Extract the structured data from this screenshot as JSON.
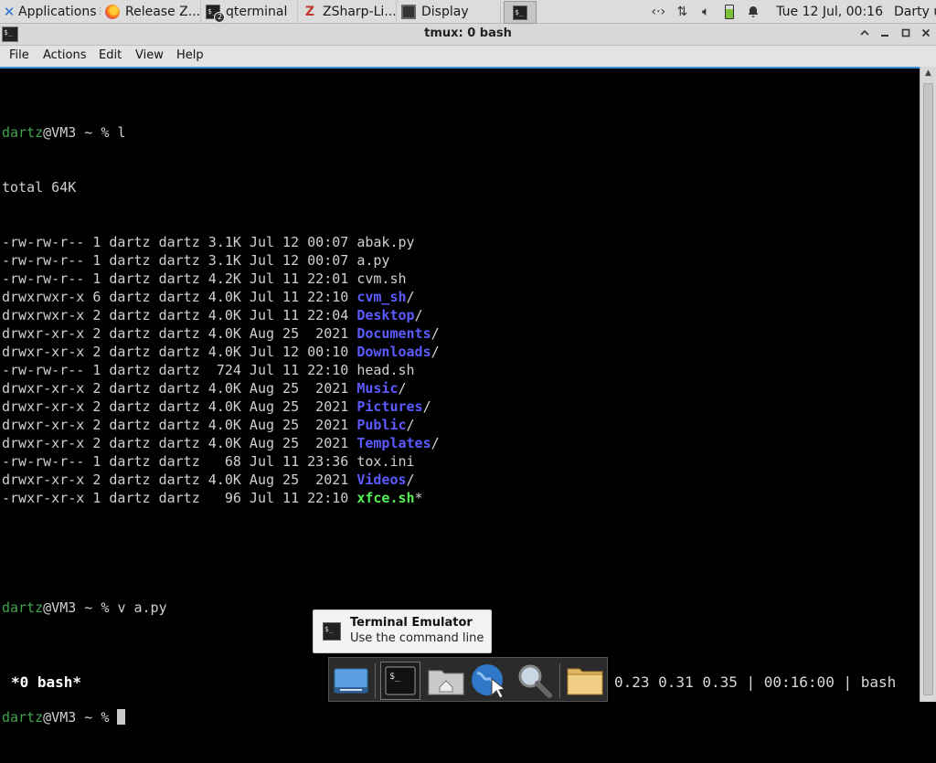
{
  "top_panel": {
    "apps_label": "Applications",
    "apps_suffix": "☰",
    "tasks": [
      {
        "label": "Release Z...",
        "icon": "firefox-icon"
      },
      {
        "label": "qterminal",
        "icon": "terminal-icon",
        "badge": "2"
      },
      {
        "label": "ZSharp-Li...",
        "icon": "zsharp-icon"
      },
      {
        "label": "Display",
        "icon": "display-icon"
      },
      {
        "label": "",
        "icon": "terminal-icon"
      }
    ],
    "tray_icons": [
      "network-arrows-icon",
      "transfer-icon",
      "volume-icon",
      "battery-icon",
      "notification-bell-icon"
    ],
    "clock": "Tue 12 Jul, 00:16",
    "user": "Darty uwu"
  },
  "window": {
    "title": "tmux: 0 bash",
    "buttons": [
      "minimize",
      "restore",
      "maximize",
      "close"
    ]
  },
  "menubar": {
    "items": [
      "File",
      "Actions",
      "Edit",
      "View",
      "Help"
    ]
  },
  "terminal": {
    "prompt_user": "dartz",
    "prompt_host": "@VM3",
    "prompt_suffix": " ~ % ",
    "cmd1": "l",
    "total": "total 64K",
    "listing": [
      {
        "meta": "-rw-rw-r-- 1 dartz dartz 3.1K Jul 12 00:07 ",
        "name": "abak.py",
        "kind": "file",
        "suffix": ""
      },
      {
        "meta": "-rw-rw-r-- 1 dartz dartz 3.1K Jul 12 00:07 ",
        "name": "a.py",
        "kind": "file",
        "suffix": ""
      },
      {
        "meta": "-rw-rw-r-- 1 dartz dartz 4.2K Jul 11 22:01 ",
        "name": "cvm.sh",
        "kind": "file",
        "suffix": ""
      },
      {
        "meta": "drwxrwxr-x 6 dartz dartz 4.0K Jul 11 22:10 ",
        "name": "cvm_sh",
        "kind": "dir",
        "suffix": "/"
      },
      {
        "meta": "drwxrwxr-x 2 dartz dartz 4.0K Jul 11 22:04 ",
        "name": "Desktop",
        "kind": "dir",
        "suffix": "/"
      },
      {
        "meta": "drwxr-xr-x 2 dartz dartz 4.0K Aug 25  2021 ",
        "name": "Documents",
        "kind": "dir",
        "suffix": "/"
      },
      {
        "meta": "drwxr-xr-x 2 dartz dartz 4.0K Jul 12 00:10 ",
        "name": "Downloads",
        "kind": "dir",
        "suffix": "/"
      },
      {
        "meta": "-rw-rw-r-- 1 dartz dartz  724 Jul 11 22:10 ",
        "name": "head.sh",
        "kind": "file",
        "suffix": ""
      },
      {
        "meta": "drwxr-xr-x 2 dartz dartz 4.0K Aug 25  2021 ",
        "name": "Music",
        "kind": "dir",
        "suffix": "/"
      },
      {
        "meta": "drwxr-xr-x 2 dartz dartz 4.0K Aug 25  2021 ",
        "name": "Pictures",
        "kind": "dir",
        "suffix": "/"
      },
      {
        "meta": "drwxr-xr-x 2 dartz dartz 4.0K Aug 25  2021 ",
        "name": "Public",
        "kind": "dir",
        "suffix": "/"
      },
      {
        "meta": "drwxr-xr-x 2 dartz dartz 4.0K Aug 25  2021 ",
        "name": "Templates",
        "kind": "dir",
        "suffix": "/"
      },
      {
        "meta": "-rw-rw-r-- 1 dartz dartz   68 Jul 11 23:36 ",
        "name": "tox.ini",
        "kind": "file",
        "suffix": ""
      },
      {
        "meta": "drwxr-xr-x 2 dartz dartz 4.0K Aug 25  2021 ",
        "name": "Videos",
        "kind": "dir",
        "suffix": "/"
      },
      {
        "meta": "-rwxr-xr-x 1 dartz dartz   96 Jul 11 22:10 ",
        "name": "xfce.sh",
        "kind": "exe",
        "suffix": "*"
      }
    ],
    "cmd2": "v a.py",
    "colors": {
      "prompt": "#3fa34d",
      "dir": "#5b5bff",
      "exe": "#55ee55",
      "text": "#d0d0d0",
      "focus_border": "#3b8fd8"
    }
  },
  "tmux_status": {
    "left": "*0 bash*",
    "right": "0.23 0.31 0.35 | 00:16:00 | bash"
  },
  "tooltip": {
    "title": "Terminal Emulator",
    "subtitle": "Use the command line"
  },
  "dock": {
    "items": [
      "show-desktop-icon",
      "terminal-icon",
      "home-folder-icon",
      "web-browser-icon",
      "app-finder-icon",
      "file-manager-icon"
    ]
  }
}
